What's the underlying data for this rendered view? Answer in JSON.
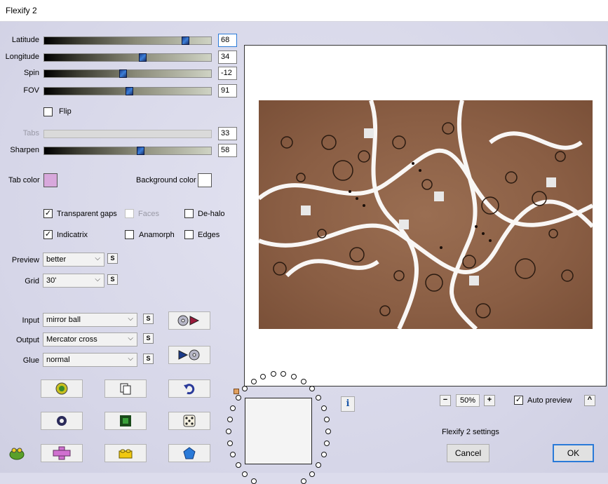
{
  "window": {
    "title": "Flexify 2"
  },
  "sliders": [
    {
      "label": "Latitude",
      "value": "68",
      "position": 0.86,
      "disabled": false,
      "focused": true
    },
    {
      "label": "Longitude",
      "value": "34",
      "position": 0.59,
      "disabled": false,
      "focused": false
    },
    {
      "label": "Spin",
      "value": "-12",
      "position": 0.47,
      "disabled": false,
      "focused": false
    },
    {
      "label": "FOV",
      "value": "91",
      "position": 0.51,
      "disabled": false,
      "focused": false
    },
    {
      "label": "Tabs",
      "value": "33",
      "position": null,
      "disabled": true,
      "focused": false
    },
    {
      "label": "Sharpen",
      "value": "58",
      "position": 0.58,
      "disabled": false,
      "focused": false
    }
  ],
  "flip": {
    "label": "Flip",
    "checked": false
  },
  "colors": {
    "tab_color_label": "Tab color",
    "tab_color": "#d8a8dc",
    "background_color_label": "Background color",
    "background_color": "#ffffff",
    "accent": "#2a7ad8",
    "slider_thumb": "#2f62b8"
  },
  "options": {
    "transparent_gaps": {
      "label": "Transparent gaps",
      "checked": true
    },
    "faces": {
      "label": "Faces",
      "checked": false,
      "disabled": true
    },
    "de_halo": {
      "label": "De-halo",
      "checked": false
    },
    "indicatrix": {
      "label": "Indicatrix",
      "checked": true
    },
    "anamorph": {
      "label": "Anamorph",
      "checked": false
    },
    "edges": {
      "label": "Edges",
      "checked": false
    }
  },
  "preview_select": {
    "label": "Preview",
    "value": "better"
  },
  "grid_select": {
    "label": "Grid",
    "value": "30'"
  },
  "input_select": {
    "label": "Input",
    "value": "mirror ball"
  },
  "output_select": {
    "label": "Output",
    "value": "Mercator cross"
  },
  "glue_select": {
    "label": "Glue",
    "value": "normal"
  },
  "s_button_label": "S",
  "tool_icons": [
    "frog-plugin-icon",
    "copy-icon",
    "undo-icon",
    "torus-icon",
    "square-frame-icon",
    "dice-icon",
    "cross-shape-icon",
    "lego-brick-icon",
    "pentagon-icon"
  ],
  "zoom": {
    "minus": "−",
    "value": "50%",
    "plus": "+"
  },
  "auto_preview": {
    "label": "Auto preview",
    "checked": true
  },
  "collapse_button": "^",
  "settings_label": "Flexify 2 settings",
  "info_button": "i",
  "buttons": {
    "cancel": "Cancel",
    "ok": "OK"
  }
}
